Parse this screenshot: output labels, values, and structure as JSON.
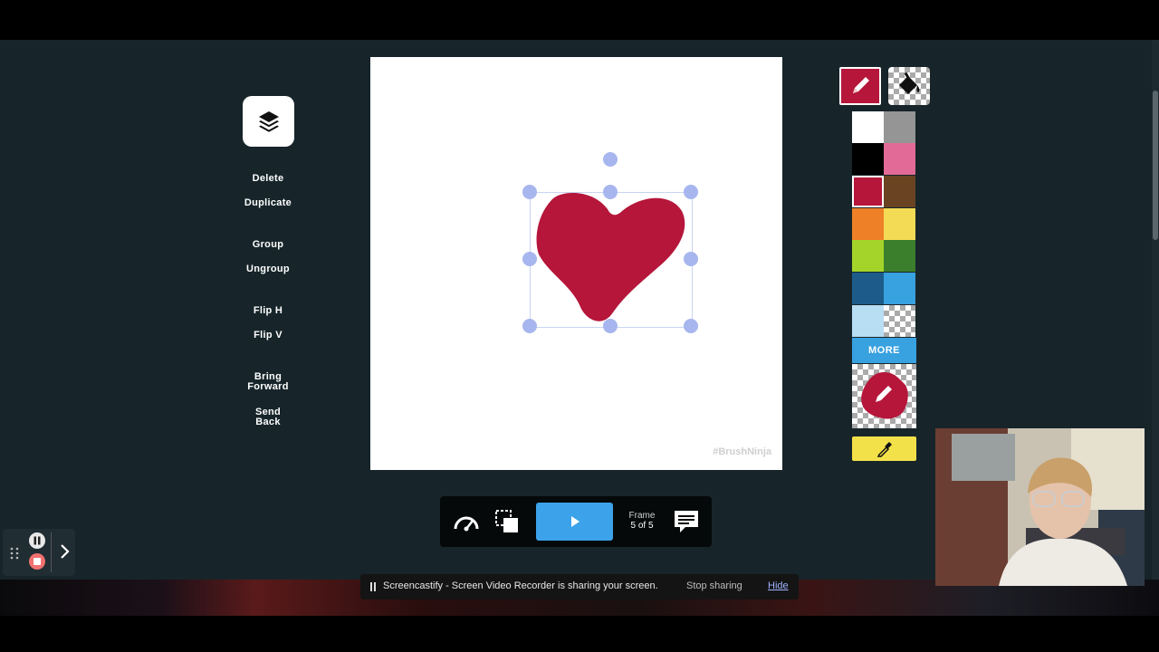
{
  "actions": {
    "delete": "Delete",
    "duplicate": "Duplicate",
    "group": "Group",
    "ungroup": "Ungroup",
    "flip_h": "Flip H",
    "flip_v": "Flip V",
    "bring_forward_1": "Bring",
    "bring_forward_2": "Forward",
    "send_back_1": "Send",
    "send_back_2": "Back"
  },
  "canvas": {
    "watermark": "#BrushNinja",
    "stroke_color": "#b5163a",
    "background": "#ffffff"
  },
  "tools": {
    "active": "pencil",
    "items": [
      "pencil-icon",
      "fill-bucket-icon"
    ]
  },
  "palette": {
    "colors": [
      "#ffffff",
      "#959595",
      "#000000",
      "#e26a96",
      "#b5163a",
      "#6a4422",
      "#ee8127",
      "#f3db55",
      "#a4d42a",
      "#3b7f2c",
      "#1d5c8a",
      "#38a1e0",
      "#b8def4",
      "transparent"
    ],
    "selected": "#b5163a",
    "more_label": "MORE"
  },
  "player": {
    "frame_word": "Frame",
    "frame_count": "5 of 5"
  },
  "share_bar": {
    "message": "Screencastify - Screen Video Recorder is sharing your screen.",
    "stop_label": "Stop sharing",
    "hide_label": "Hide"
  }
}
